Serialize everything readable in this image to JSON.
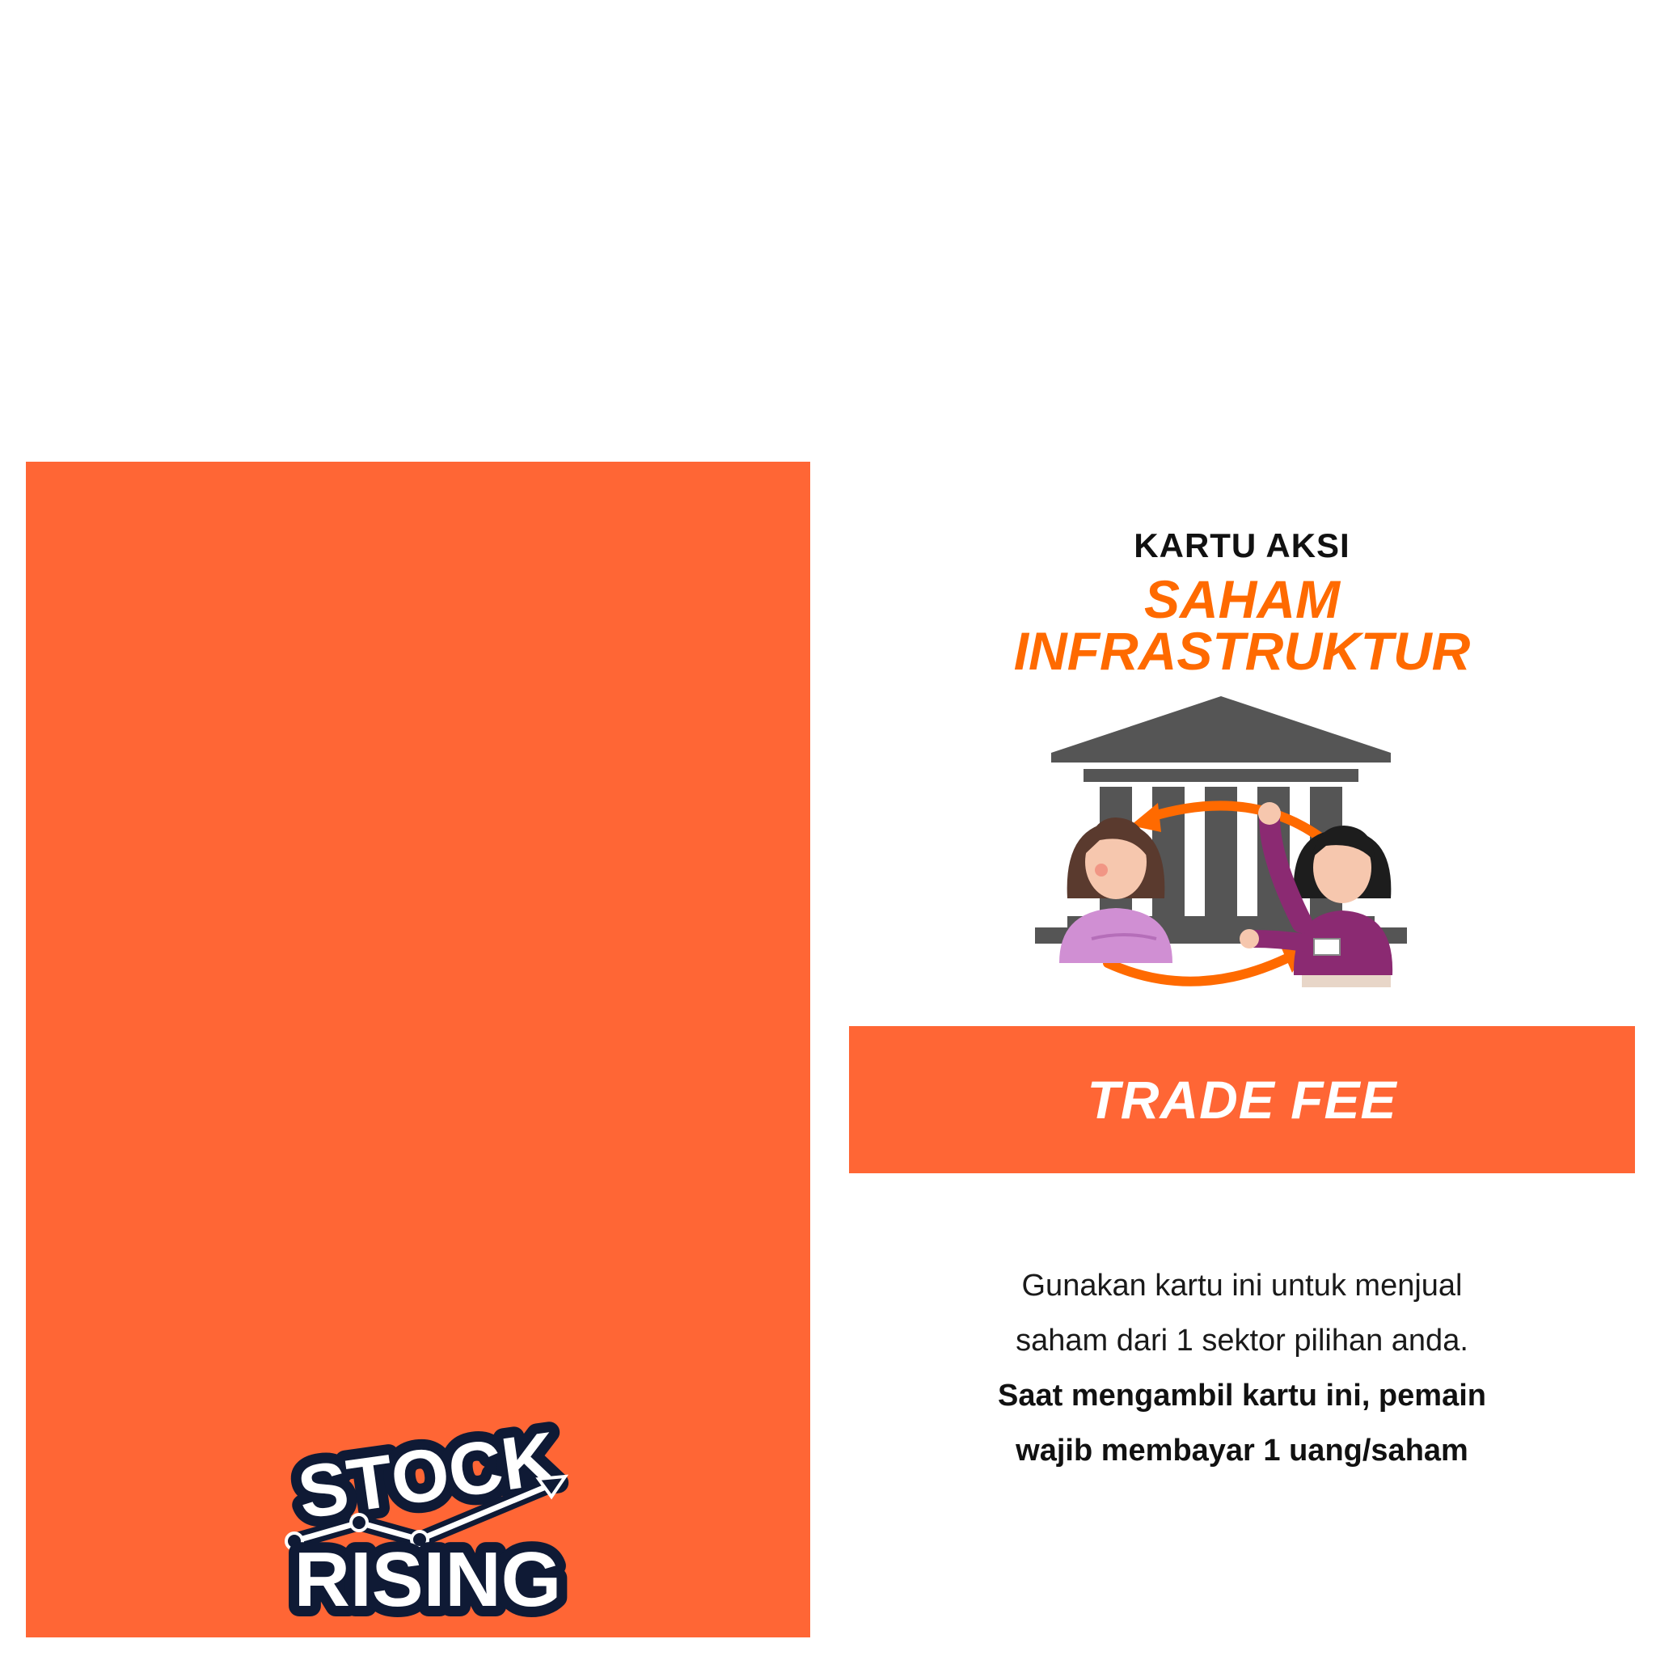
{
  "colors": {
    "accent": "#ff6635",
    "title_orange": "#ff6a00",
    "logo_navy": "#0f1a35"
  },
  "card_back": {
    "logo": {
      "line1": "STOCK",
      "line2": "RISING"
    }
  },
  "card_front": {
    "label": "KARTU AKSI",
    "title_line1": "SAHAM",
    "title_line2": "INFRASTRUKTUR",
    "illustration_icon": "bank-with-two-people-icon",
    "banner": "TRADE FEE",
    "description_line1": "Gunakan kartu ini untuk menjual",
    "description_line2": "saham dari 1 sektor pilihan anda.",
    "rule_line1": "Saat mengambil kartu ini, pemain",
    "rule_line2": "wajib membayar 1 uang/saham"
  }
}
